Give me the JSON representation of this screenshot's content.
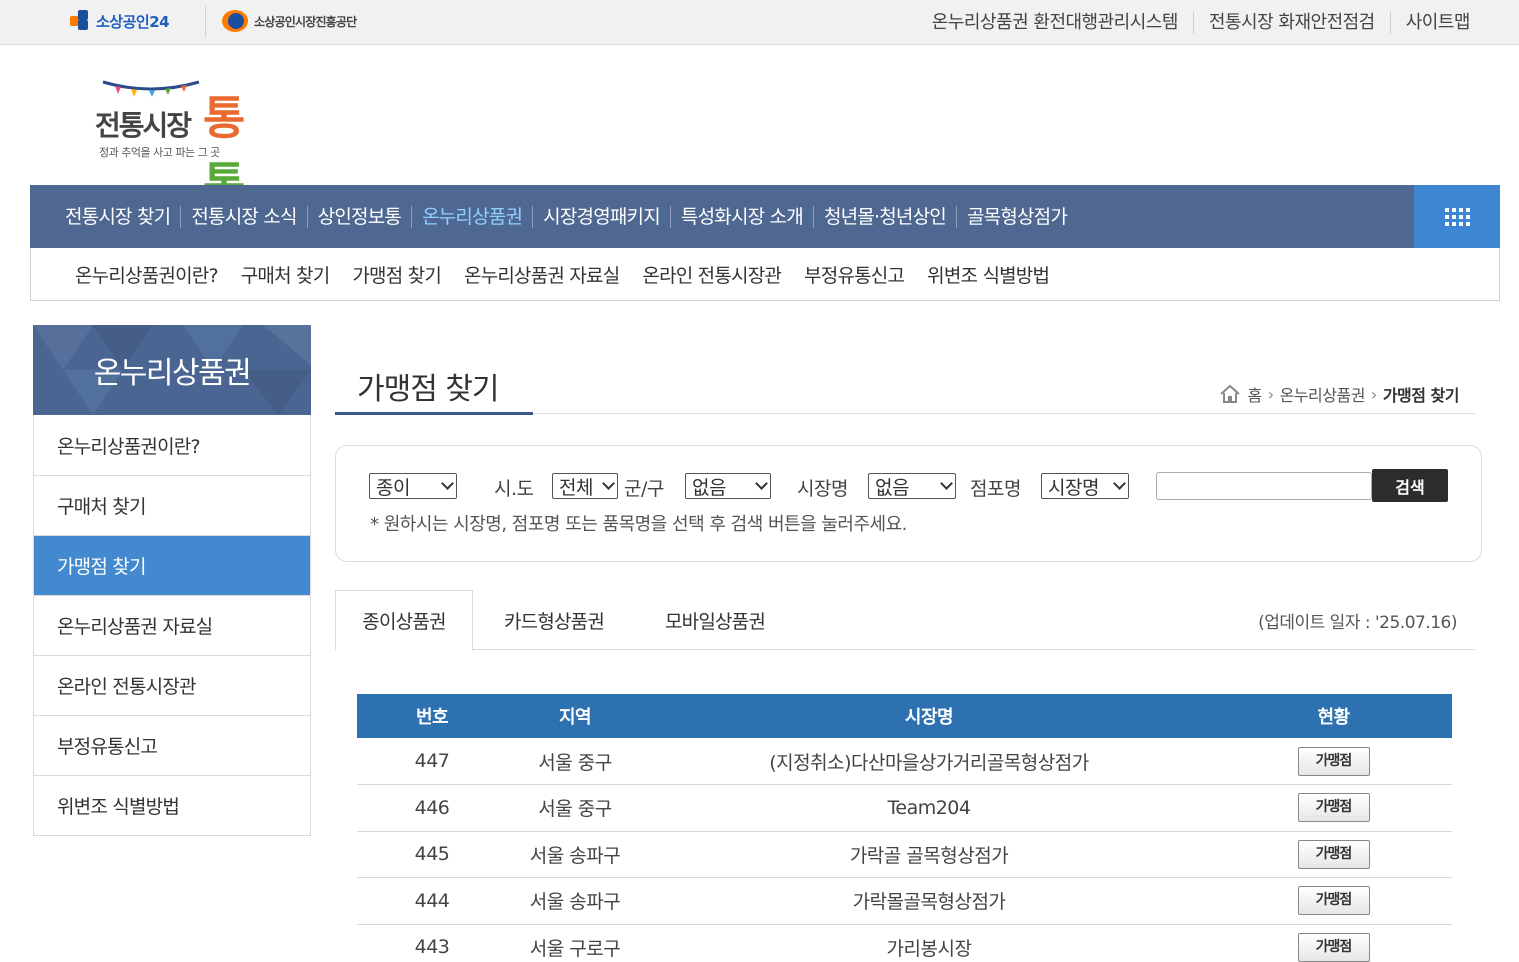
{
  "topbar": {
    "logo1": "소상공인24",
    "logo2": "소상공인시장진흥공단",
    "links": [
      "온누리상품권 환전대행관리시스템",
      "전통시장 화재안전점검",
      "사이트맵"
    ]
  },
  "brand": {
    "word1": "전통시장",
    "word2a": "통",
    "word2b": "통",
    "tagline": "정과 추억을 사고 파는 그 곳"
  },
  "mainnav": {
    "items": [
      "전통시장 찾기",
      "전통시장 소식",
      "상인정보통",
      "온누리상품권",
      "시장경영패키지",
      "특성화시장 소개",
      "청년몰·청년상인",
      "골목형상점가"
    ],
    "active_index": 3
  },
  "subnav": {
    "items": [
      "온누리상품권이란?",
      "구매처 찾기",
      "가맹점 찾기",
      "온누리상품권 자료실",
      "온라인 전통시장관",
      "부정유통신고",
      "위변조 식별방법"
    ]
  },
  "sidebar": {
    "title": "온누리상품권",
    "items": [
      "온누리상품권이란?",
      "구매처 찾기",
      "가맹점 찾기",
      "온누리상품권 자료실",
      "온라인 전통시장관",
      "부정유통신고",
      "위변조 식별방법"
    ],
    "active_index": 2
  },
  "page": {
    "title": "가맹점 찾기",
    "breadcrumb": [
      "홈",
      "온누리상품권",
      "가맹점 찾기"
    ]
  },
  "search": {
    "type_value": "종이",
    "sido_label": "시.도",
    "sido_value": "전체",
    "gugun_label": "군/구",
    "gugun_value": "없음",
    "market_label": "시장명",
    "market_value": "없음",
    "store_label": "점포명",
    "store_value": "시장명",
    "keyword_value": "",
    "button": "검색",
    "hint": "* 원하시는 시장명, 점포명 또는 품목명을 선택 후 검색 버튼을 눌러주세요."
  },
  "tabs": {
    "items": [
      "종이상품권",
      "카드형상품권",
      "모바일상품권"
    ],
    "active_index": 0,
    "update": "(업데이트 일자 : '25.07.16)"
  },
  "table": {
    "headers": [
      "번호",
      "지역",
      "시장명",
      "현황"
    ],
    "rows": [
      {
        "no": "447",
        "region": "서울 중구",
        "market": "(지정취소)다산마을상가거리골목형상점가",
        "status": "가맹점"
      },
      {
        "no": "446",
        "region": "서울 중구",
        "market": "Team204",
        "status": "가맹점"
      },
      {
        "no": "445",
        "region": "서울 송파구",
        "market": "가락골 골목형상점가",
        "status": "가맹점"
      },
      {
        "no": "444",
        "region": "서울 송파구",
        "market": "가락몰골목형상점가",
        "status": "가맹점"
      },
      {
        "no": "443",
        "region": "서울 구로구",
        "market": "가리봉시장",
        "status": "가맹점"
      }
    ]
  },
  "colors": {
    "nav_bg": "#4f6891",
    "accent_blue": "#4289d0",
    "table_header": "#2d71b0",
    "brand_orange": "#e86a2e",
    "brand_green": "#5aaa3a"
  }
}
